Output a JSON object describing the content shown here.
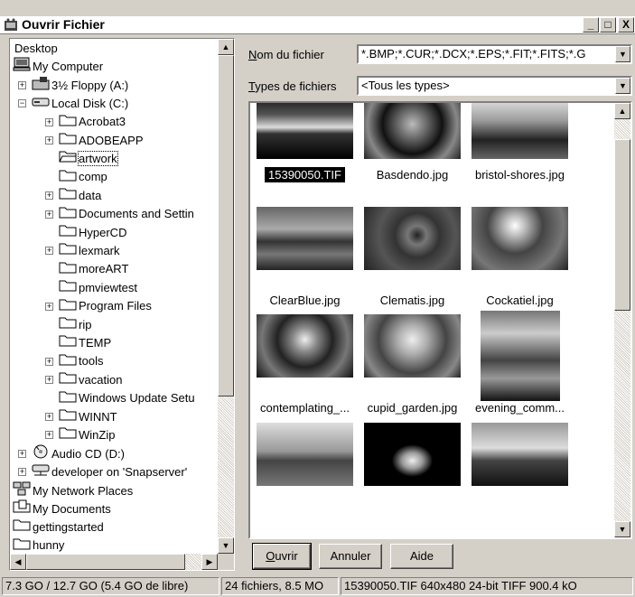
{
  "window": {
    "title": "Ouvrir Fichier",
    "minimize": "_",
    "maximize": "□",
    "close": "X"
  },
  "tree": {
    "items": [
      {
        "label": "Desktop",
        "icon": "desktop-icon"
      },
      {
        "label": "My Computer",
        "icon": "computer-icon"
      },
      {
        "label": "3½ Floppy (A:)",
        "icon": "floppy-icon"
      },
      {
        "label": "Local Disk (C:)",
        "icon": "drive-icon"
      },
      {
        "label": "Acrobat3",
        "icon": "folder-icon"
      },
      {
        "label": "ADOBEAPP",
        "icon": "folder-icon"
      },
      {
        "label": "artwork",
        "icon": "open-folder-icon"
      },
      {
        "label": "comp",
        "icon": "folder-icon"
      },
      {
        "label": "data",
        "icon": "folder-icon"
      },
      {
        "label": "Documents and Settin",
        "icon": "folder-icon"
      },
      {
        "label": "HyperCD",
        "icon": "folder-icon"
      },
      {
        "label": "lexmark",
        "icon": "folder-icon"
      },
      {
        "label": "moreART",
        "icon": "folder-icon"
      },
      {
        "label": "pmviewtest",
        "icon": "folder-icon"
      },
      {
        "label": "Program Files",
        "icon": "folder-icon"
      },
      {
        "label": "rip",
        "icon": "folder-icon"
      },
      {
        "label": "TEMP",
        "icon": "folder-icon"
      },
      {
        "label": "tools",
        "icon": "folder-icon"
      },
      {
        "label": "vacation",
        "icon": "folder-icon"
      },
      {
        "label": "Windows Update Setu",
        "icon": "folder-icon"
      },
      {
        "label": "WINNT",
        "icon": "folder-icon"
      },
      {
        "label": "WinZip",
        "icon": "folder-icon"
      },
      {
        "label": "Audio CD (D:)",
        "icon": "cd-icon"
      },
      {
        "label": "developer on 'Snapserver'",
        "icon": "network-drive-icon"
      },
      {
        "label": "My Network Places",
        "icon": "network-icon"
      },
      {
        "label": "My Documents",
        "icon": "documents-icon"
      },
      {
        "label": "gettingstarted",
        "icon": "folder-icon"
      },
      {
        "label": "hunny",
        "icon": "folder-icon"
      }
    ]
  },
  "form": {
    "filename_label_u": "N",
    "filename_label_rest": "om du fichier",
    "filename_value": "*.BMP;*.CUR;*.DCX;*.EPS;*.FIT;*.FITS;*.G",
    "filetype_label_u": "T",
    "filetype_label_rest": "ypes de fichiers",
    "filetype_value": "<Tous les types>"
  },
  "thumbnails": [
    {
      "name": "15390050.TIF"
    },
    {
      "name": "Basdendo.jpg"
    },
    {
      "name": "bristol-shores.jpg"
    },
    {
      "name": "ClearBlue.jpg"
    },
    {
      "name": "Clematis.jpg"
    },
    {
      "name": "Cockatiel.jpg"
    },
    {
      "name": "contemplating_..."
    },
    {
      "name": "cupid_garden.jpg"
    },
    {
      "name": "evening_comm..."
    },
    {
      "name": ""
    },
    {
      "name": ""
    },
    {
      "name": ""
    }
  ],
  "buttons": {
    "open_u": "O",
    "open_rest": "uvrir",
    "cancel": "Annuler",
    "help": "Aide"
  },
  "status": {
    "disk": "7.3 GO / 12.7 GO (5.4 GO de libre)",
    "files": "24 fichiers, 8.5 MO",
    "selection": "15390050.TIF  640x480 24-bit TIFF  900.4 kO"
  }
}
